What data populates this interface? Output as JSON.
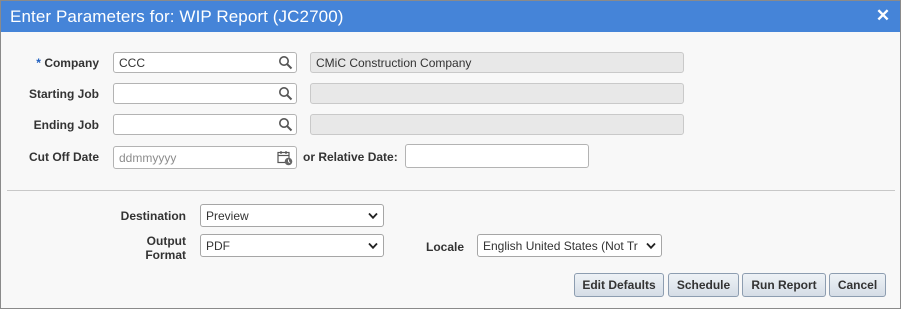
{
  "dialog": {
    "title": "Enter Parameters for: WIP Report (JC2700)",
    "close_glyph": "✕"
  },
  "form": {
    "company": {
      "required_mark": "*",
      "label": "Company",
      "value": "CCC",
      "description": "CMiC Construction Company",
      "icon": "search-icon"
    },
    "starting_job": {
      "label": "Starting Job",
      "value": "",
      "description": "",
      "icon": "search-icon"
    },
    "ending_job": {
      "label": "Ending Job",
      "value": "",
      "description": "",
      "icon": "search-icon"
    },
    "cut_off_date": {
      "label": "Cut Off Date",
      "placeholder": "ddmmyyyy",
      "icon": "calendar-icon"
    },
    "relative_date": {
      "label": "or Relative Date:",
      "value": ""
    }
  },
  "output": {
    "destination": {
      "label": "Destination",
      "selected": "Preview"
    },
    "output_format": {
      "label_line1": "Output",
      "label_line2": "Format",
      "selected": "PDF"
    },
    "locale": {
      "label": "Locale",
      "selected": "English United States (Not Tr"
    }
  },
  "buttons": {
    "edit_defaults": "Edit Defaults",
    "schedule": "Schedule",
    "run_report": "Run Report",
    "cancel": "Cancel"
  },
  "colors": {
    "titlebar": "#4584d8",
    "required_asterisk": "#1f5fbf",
    "readonly_field": "#e8e8e8"
  }
}
